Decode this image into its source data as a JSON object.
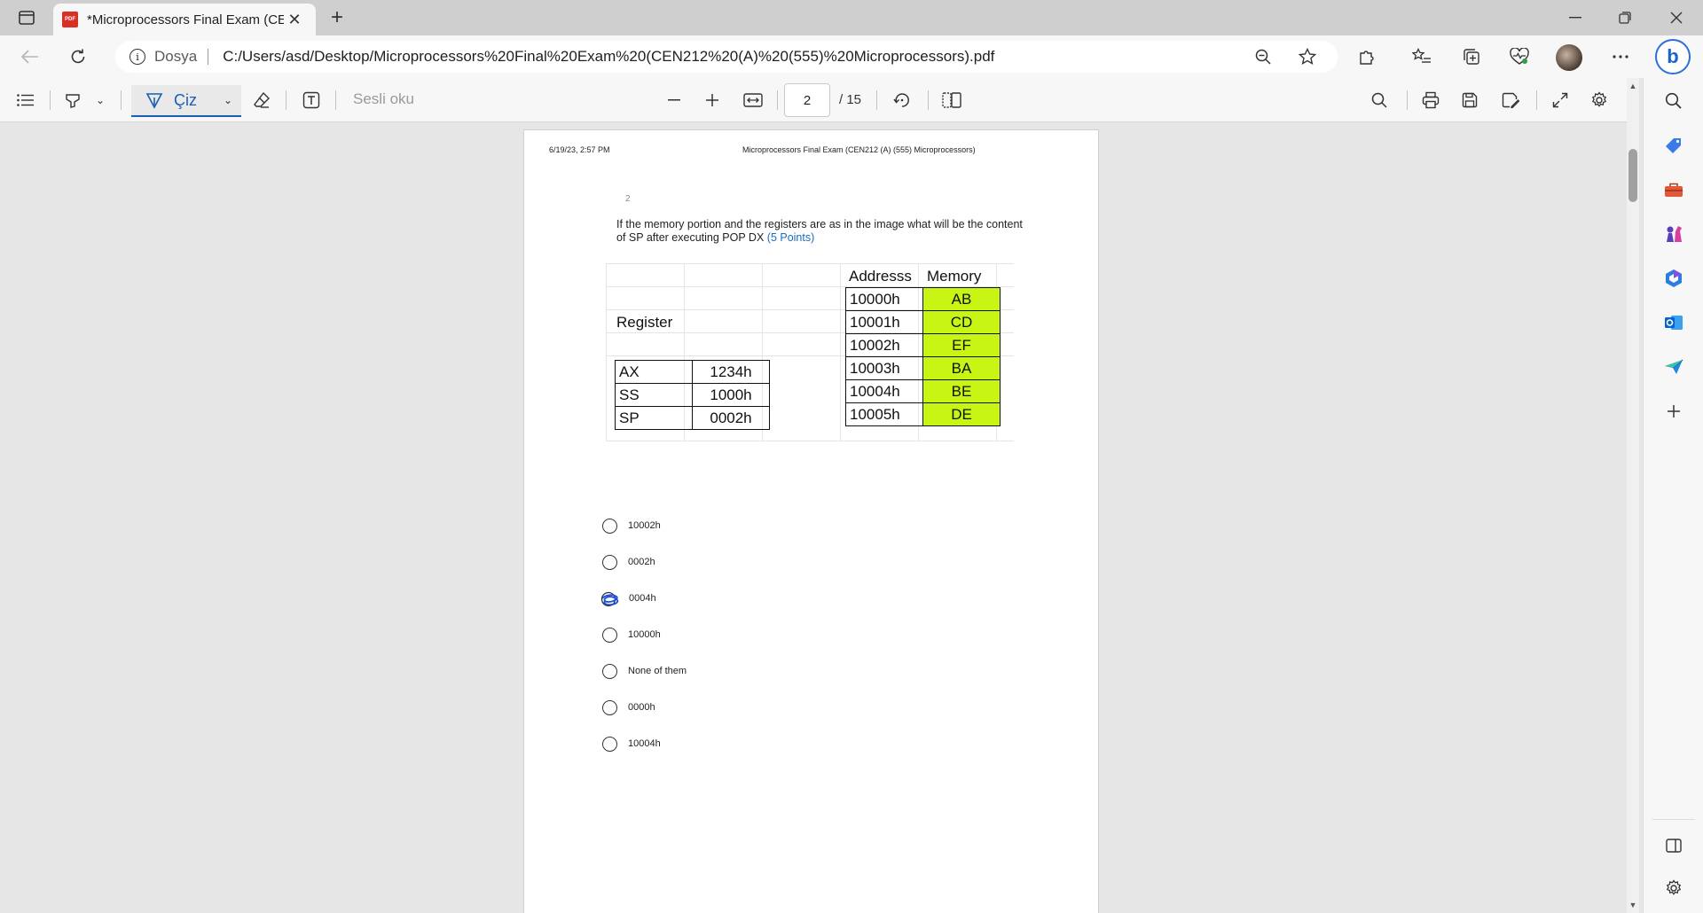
{
  "browser": {
    "tab_title": "*Microprocessors Final Exam (CEN212 (A) (555) Microprocessors)",
    "tab_title_visible": "*Microprocessors Final Exam (CE",
    "pdf_badge": "PDF",
    "new_tab": "+",
    "scheme_label": "Dosya",
    "url": "C:/Users/asd/Desktop/Microprocessors%20Final%20Exam%20(CEN212%20(A)%20(555)%20Microprocessors).pdf",
    "bing_label": "b"
  },
  "pdf_toolbar": {
    "draw_label": "Çiz",
    "read_aloud_label": "Sesli oku",
    "page_current": "2",
    "page_total": "/ 15"
  },
  "document": {
    "header_date": "6/19/23, 2:57 PM",
    "header_title": "Microprocessors Final Exam (CEN212 (A) (555) Microprocessors)",
    "question_number": "2",
    "question_text": "If the memory portion and the registers are as in the image what will be the content of SP after executing POP DX",
    "question_points": "(5 Points)",
    "figure": {
      "register_title": "Register",
      "registers": [
        {
          "name": "AX",
          "value": "1234h"
        },
        {
          "name": "SS",
          "value": "1000h"
        },
        {
          "name": "SP",
          "value": "0002h"
        }
      ],
      "address_header": "Addresss",
      "memory_header": "Memory",
      "memory": [
        {
          "address": "10000h",
          "value": "AB"
        },
        {
          "address": "10001h",
          "value": "CD"
        },
        {
          "address": "10002h",
          "value": "EF"
        },
        {
          "address": "10003h",
          "value": "BA"
        },
        {
          "address": "10004h",
          "value": "BE"
        },
        {
          "address": "10005h",
          "value": "DE"
        }
      ],
      "memory_fill_color": "#c9f514"
    },
    "options": [
      {
        "label": "10002h",
        "marked": false
      },
      {
        "label": "0002h",
        "marked": false
      },
      {
        "label": "0004h",
        "marked": true
      },
      {
        "label": "10000h",
        "marked": false
      },
      {
        "label": "None of them",
        "marked": false
      },
      {
        "label": "0000h",
        "marked": false
      },
      {
        "label": "10004h",
        "marked": false
      }
    ]
  },
  "colors": {
    "accent": "#1a5fb4",
    "points_link": "#1a6cc4",
    "scribble": "#1d4fd8"
  }
}
